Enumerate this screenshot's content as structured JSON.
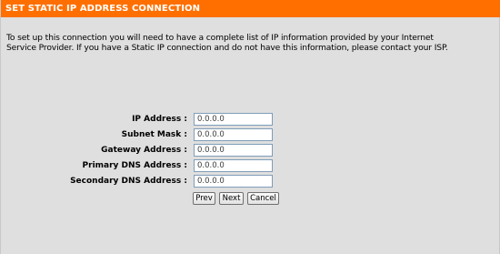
{
  "header": {
    "title": "SET STATIC IP ADDRESS CONNECTION"
  },
  "description": {
    "line1": "To set up this connection you will need to have a complete list of IP information provided by your Internet",
    "line2": "Service Provider. If you have a Static IP connection and do not have this information, please contact your ISP."
  },
  "form": {
    "fields": [
      {
        "label": "IP Address :",
        "value": "0.0.0.0"
      },
      {
        "label": "Subnet Mask :",
        "value": "0.0.0.0"
      },
      {
        "label": "Gateway Address :",
        "value": "0.0.0.0"
      },
      {
        "label": "Primary DNS Address :",
        "value": "0.0.0.0"
      },
      {
        "label": "Secondary DNS Address :",
        "value": "0.0.0.0"
      }
    ]
  },
  "buttons": {
    "prev": "Prev",
    "next": "Next",
    "cancel": "Cancel"
  },
  "colors": {
    "header_bg": "#ff6f00",
    "header_text": "#ffffff",
    "panel_bg": "#dfdfdf",
    "field_border": "#7f9db9"
  }
}
